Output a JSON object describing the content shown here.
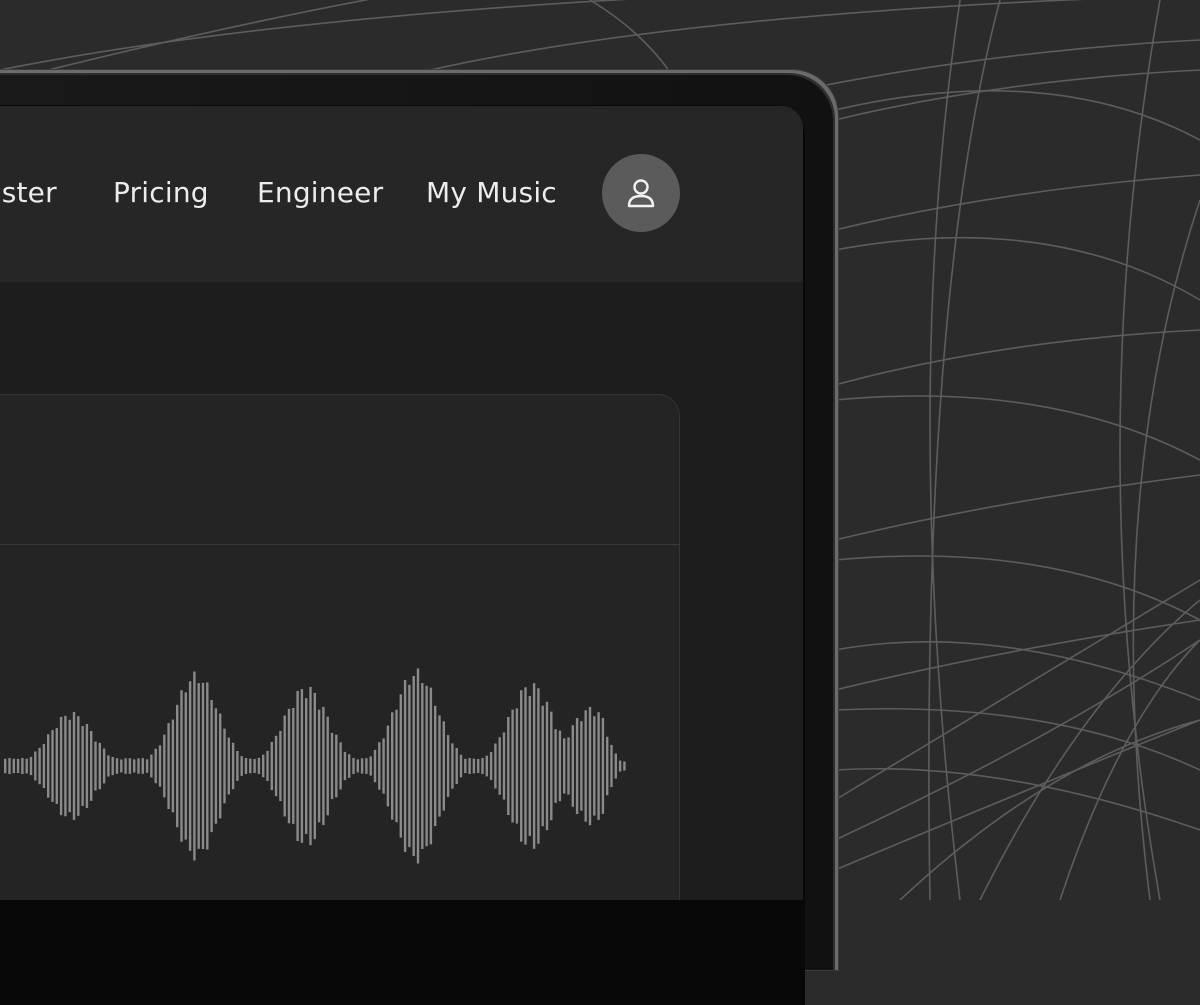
{
  "nav": {
    "items": [
      {
        "label": "Master"
      },
      {
        "label": "Pricing"
      },
      {
        "label": "Engineer"
      },
      {
        "label": "My Music"
      }
    ]
  },
  "icons": {
    "profile": "user-icon"
  },
  "colors": {
    "background": "#2b2b2b",
    "screen": "#1d1d1d",
    "navbar": "#262626",
    "card": "#242424",
    "avatar": "#5b5b5b",
    "waveform": "#8a8a8a",
    "nav_text": "#ececec"
  }
}
